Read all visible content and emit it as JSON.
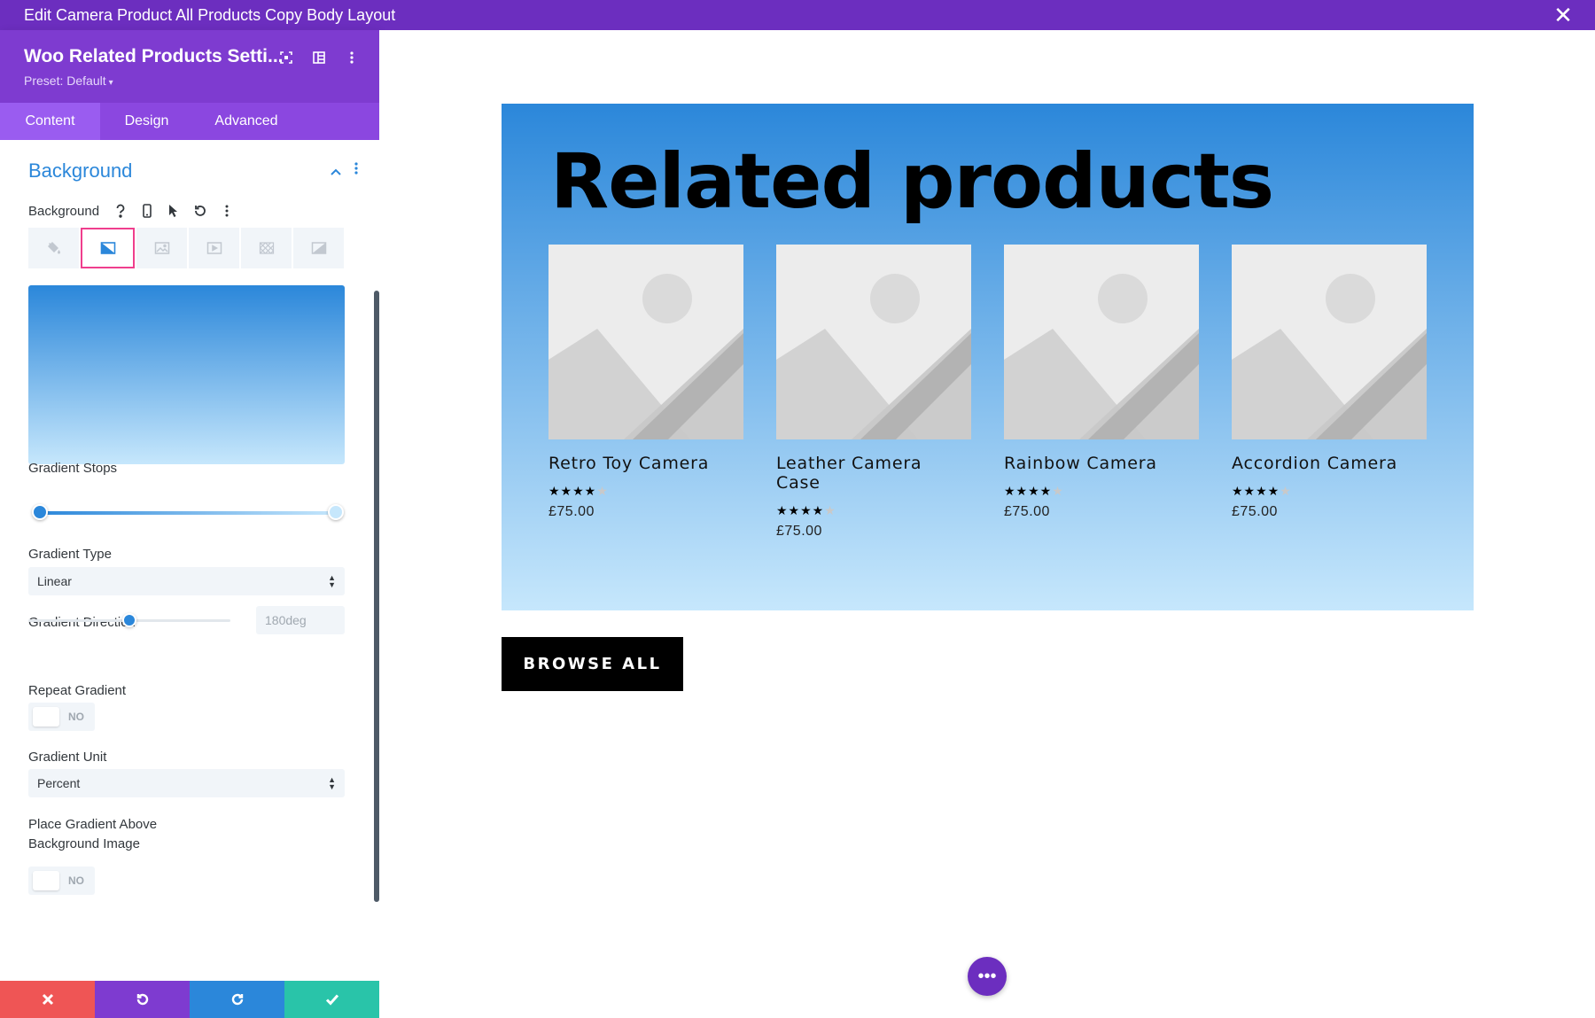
{
  "window": {
    "title": "Edit Camera Product All Products Copy Body Layout",
    "close_icon": "close-icon"
  },
  "panel": {
    "title": "Woo Related Products Setti...",
    "preset": "Preset: Default",
    "tabs": [
      {
        "label": "Content",
        "active": true
      },
      {
        "label": "Design",
        "active": false
      },
      {
        "label": "Advanced",
        "active": false
      }
    ],
    "section_title": "Background",
    "background_label": "Background",
    "bg_type_tabs": [
      "color",
      "gradient",
      "image",
      "video",
      "pattern",
      "mask"
    ],
    "active_bg_tab": "gradient",
    "gradient": {
      "stops_label": "Gradient Stops",
      "stops": [
        "#2b87da",
        "#c6e7fc"
      ],
      "type_label": "Gradient Type",
      "type_value": "Linear",
      "direction_label": "Gradient Direction",
      "direction_value": "180deg",
      "direction_level_percent": 50,
      "repeat_label": "Repeat Gradient",
      "repeat_value": "NO",
      "unit_label": "Gradient Unit",
      "unit_value": "Percent",
      "place_above_label_1": "Place Gradient Above",
      "place_above_label_2": "Background Image",
      "place_above_value": "NO"
    }
  },
  "colors": {
    "brand": "#6c2ebf",
    "accent": "#2b87da",
    "cancel": "#ef5555",
    "undo": "#7e3bd0",
    "redo": "#2b87da",
    "save": "#29c4a9"
  },
  "canvas": {
    "module_title": "Related products",
    "products": [
      {
        "name": "Retro Toy Camera",
        "rating": 4,
        "price": "£75.00"
      },
      {
        "name": "Leather Camera Case",
        "rating": 4,
        "price": "£75.00"
      },
      {
        "name": "Rainbow Camera",
        "rating": 4,
        "price": "£75.00"
      },
      {
        "name": "Accordion Camera",
        "rating": 4,
        "price": "£75.00"
      }
    ],
    "browse_button": "BROWSE ALL",
    "fab_label": "•••"
  }
}
